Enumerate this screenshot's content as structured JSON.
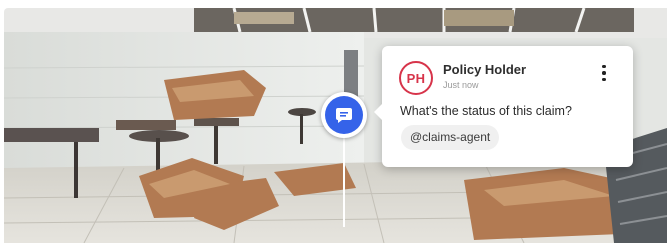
{
  "scene": {
    "description_icon": "photo-panorama"
  },
  "pin": {
    "icon": "comment-icon",
    "accent": "#3563e9"
  },
  "comment": {
    "avatar_initials": "PH",
    "avatar_color": "#d7344a",
    "author": "Policy Holder",
    "timestamp": "Just now",
    "message": "What's the status of this claim?",
    "mention": "@claims-agent",
    "menu_icon": "more-vertical-icon"
  }
}
